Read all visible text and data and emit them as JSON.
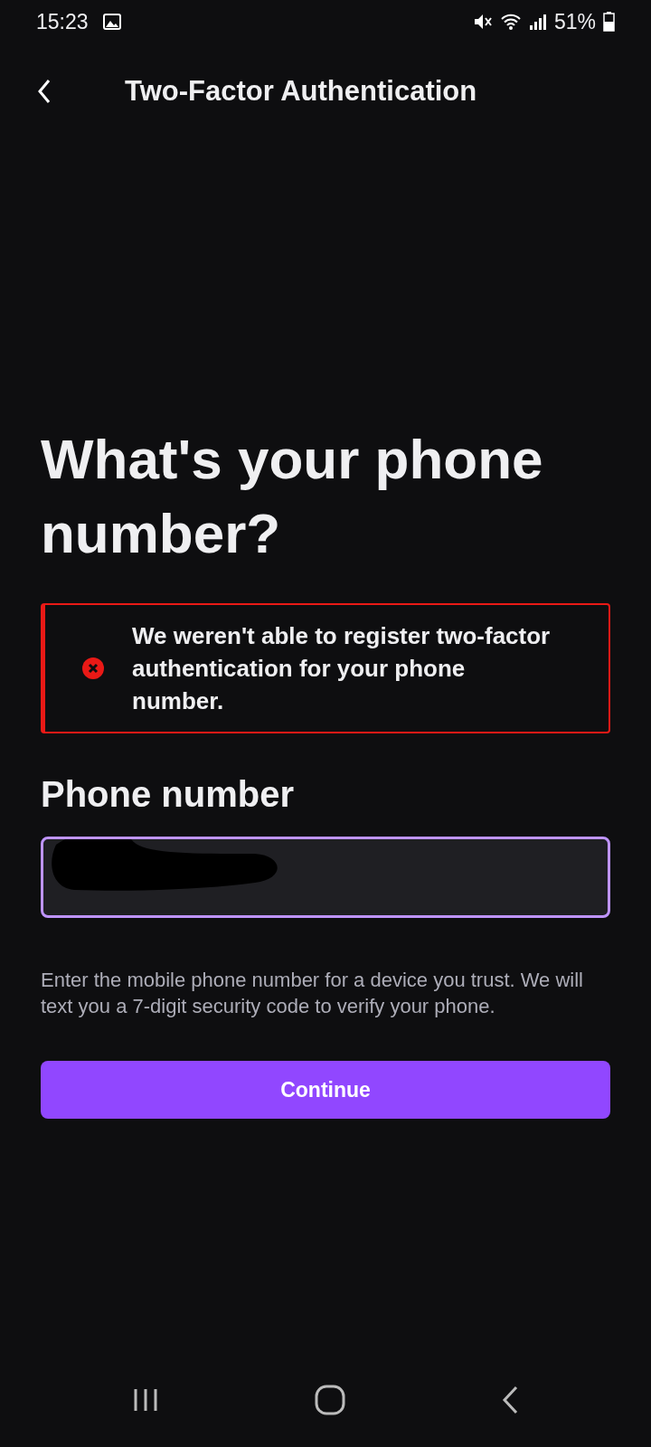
{
  "status_bar": {
    "time": "15:23",
    "battery": "51%"
  },
  "header": {
    "title": "Two-Factor Authentication"
  },
  "heading": "What's your phone number?",
  "error": {
    "message": "We weren't able to register two-factor authentication for your phone number."
  },
  "phone_field": {
    "label": "Phone number",
    "focused": true
  },
  "helper_text": "Enter the mobile phone number for a device you trust. We will text you a 7-digit security code to verify your phone.",
  "button": {
    "label": "Continue"
  }
}
